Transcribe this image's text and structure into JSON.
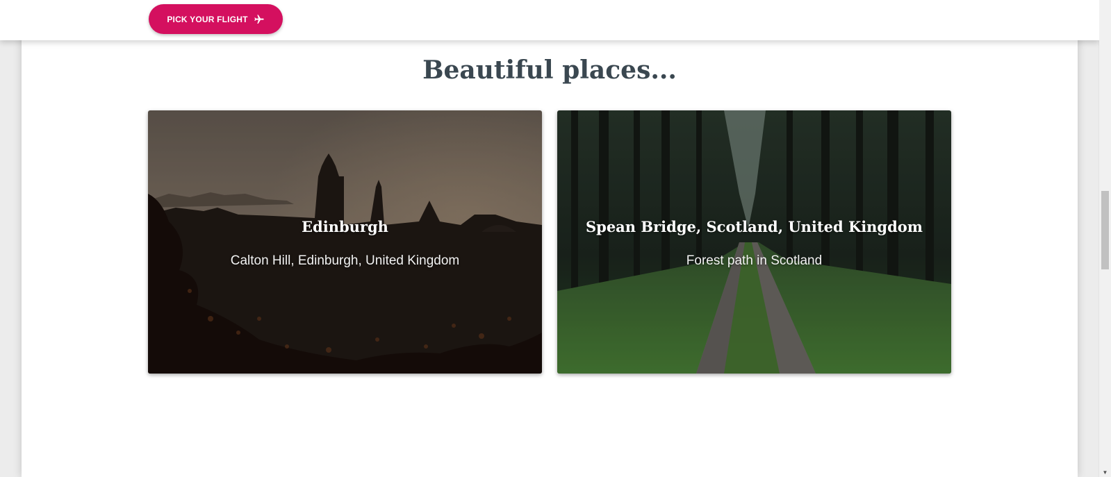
{
  "header": {
    "cta_label": "PICK YOUR FLIGHT",
    "cta_icon": "airplane-icon",
    "cta_color": "#d4105f"
  },
  "section": {
    "title": "Beautiful places..."
  },
  "places": [
    {
      "title": "Edinburgh",
      "subtitle": "Calton Hill, Edinburgh, United Kingdom"
    },
    {
      "title": "Spean Bridge, Scotland, United Kingdom",
      "subtitle": "Forest path in Scotland"
    }
  ],
  "scrollbar": {
    "down_arrow": "▼"
  }
}
